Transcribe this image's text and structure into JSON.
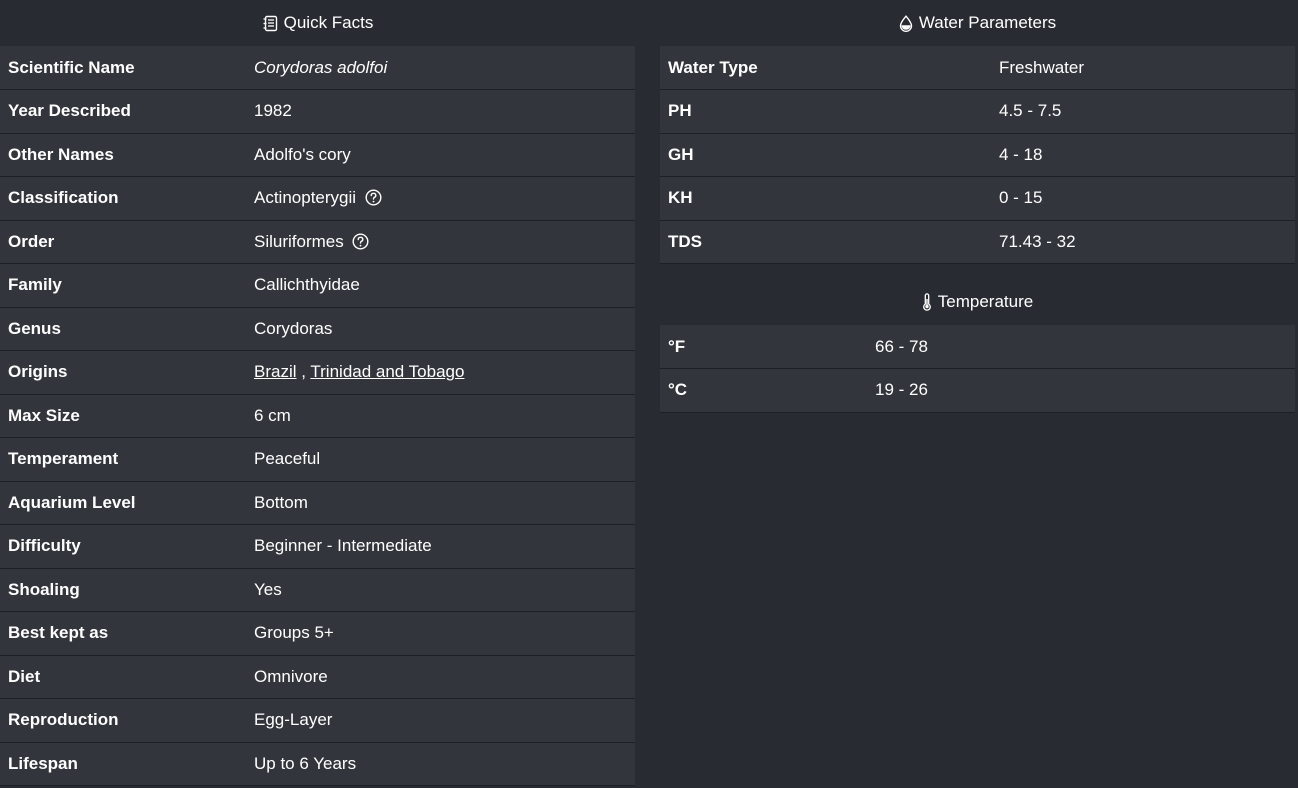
{
  "quick_facts": {
    "title": "Quick Facts",
    "icon": "journal-icon",
    "rows": [
      {
        "label": "Scientific Name",
        "value": "Corydoras adolfoi"
      },
      {
        "label": "Year Described",
        "value": "1982"
      },
      {
        "label": "Other Names",
        "value": "Adolfo's cory"
      },
      {
        "label": "Classification",
        "value": "Actinopterygii"
      },
      {
        "label": "Order",
        "value": "Siluriformes"
      },
      {
        "label": "Family",
        "value": "Callichthyidae"
      },
      {
        "label": "Genus",
        "value": "Corydoras"
      },
      {
        "label": "Origins",
        "links": [
          "Brazil",
          "Trinidad and Tobago"
        ],
        "separator": " , "
      },
      {
        "label": "Max Size",
        "value": "6 cm"
      },
      {
        "label": "Temperament",
        "value": "Peaceful"
      },
      {
        "label": "Aquarium Level",
        "value": "Bottom"
      },
      {
        "label": "Difficulty",
        "value": "Beginner - Intermediate"
      },
      {
        "label": "Shoaling",
        "value": "Yes"
      },
      {
        "label": "Best kept as",
        "value": "Groups 5+"
      },
      {
        "label": "Diet",
        "value": "Omnivore"
      },
      {
        "label": "Reproduction",
        "value": "Egg-Layer"
      },
      {
        "label": "Lifespan",
        "value": "Up to 6 Years"
      }
    ]
  },
  "water_parameters": {
    "title": "Water Parameters",
    "icon": "droplet-icon",
    "rows": [
      {
        "label": "Water Type",
        "value": "Freshwater"
      },
      {
        "label": "PH",
        "value": "4.5 - 7.5"
      },
      {
        "label": "GH",
        "value": "4 - 18"
      },
      {
        "label": "KH",
        "value": "0 - 15"
      },
      {
        "label": "TDS",
        "value": "71.43 - 32"
      }
    ]
  },
  "temperature": {
    "title": "Temperature",
    "icon": "thermometer-icon",
    "rows": [
      {
        "label": "°F",
        "value": "66 - 78"
      },
      {
        "label": "°C",
        "value": "19 - 26"
      }
    ]
  },
  "colors": {
    "background": "#282b31",
    "table_row": "#32353b",
    "row_border": "#1d1f23",
    "text": "#ffffff"
  }
}
